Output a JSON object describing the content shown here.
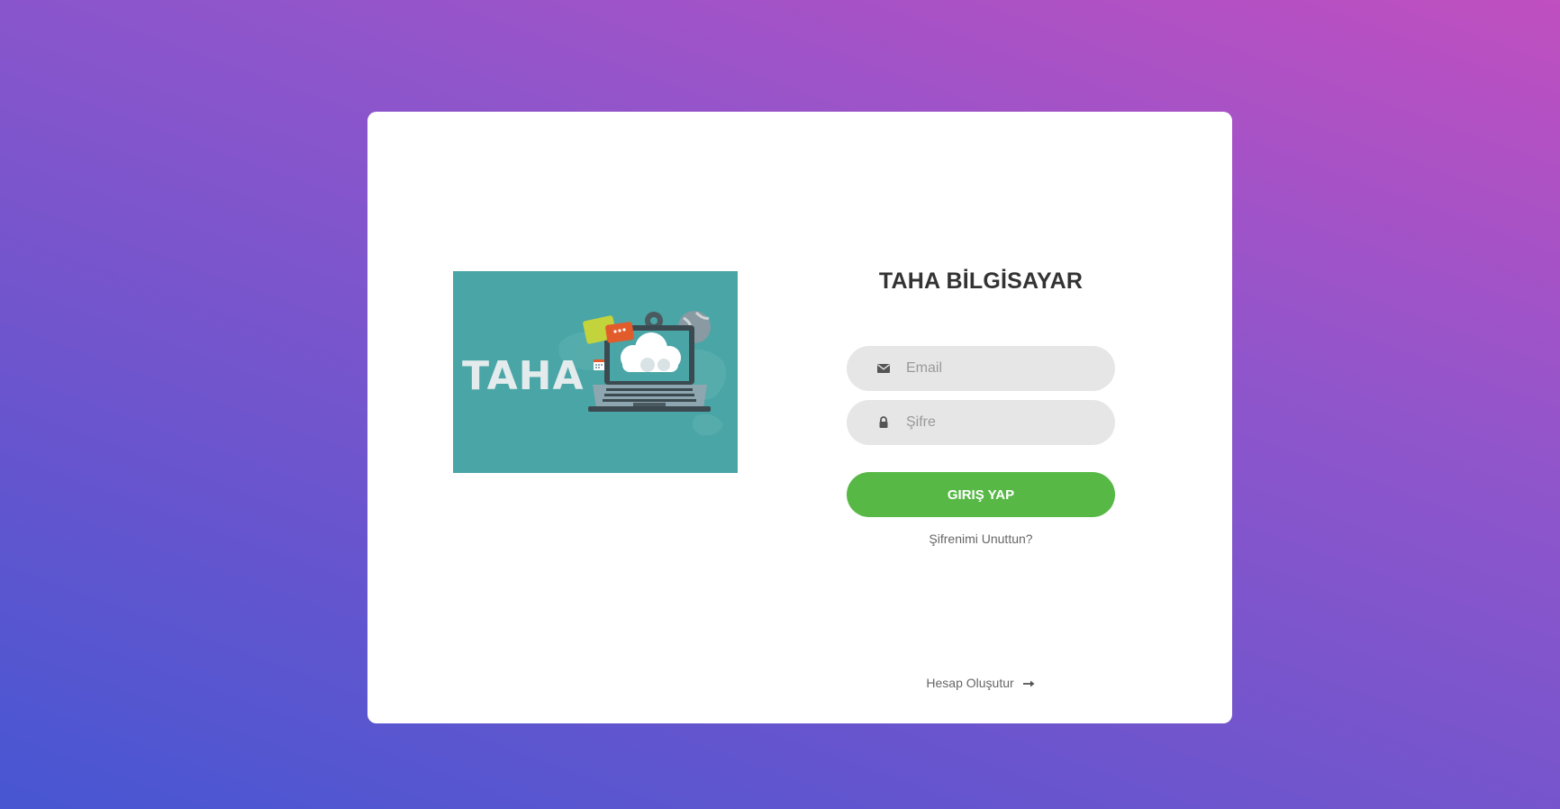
{
  "brand": {
    "logo_text": "TAHA",
    "title": "TAHA BİLGİSAYAR"
  },
  "form": {
    "email": {
      "placeholder": "Email",
      "value": "",
      "icon": "envelope-icon"
    },
    "password": {
      "placeholder": "Şifre",
      "value": "",
      "icon": "lock-icon"
    },
    "login_label": "GIRIŞ YAP",
    "forgot_label": "Şifrenimi Unuttun?",
    "create_label": "Hesap Oluşutur",
    "create_icon": "arrow-right-icon"
  },
  "colors": {
    "background_start": "#4756d2",
    "background_end": "#c04fc0",
    "card": "#ffffff",
    "field": "#e6e6e6",
    "login_button": "#57b846",
    "logo_background": "#4aa5a6"
  }
}
